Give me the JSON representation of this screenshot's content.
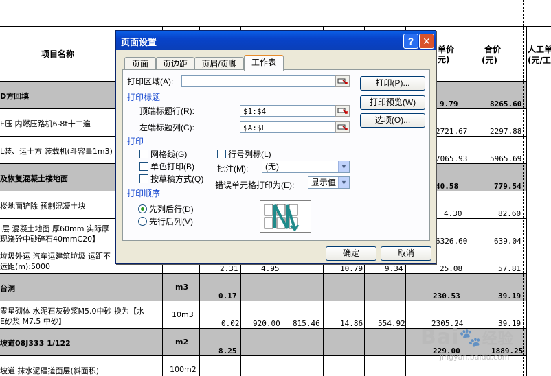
{
  "spreadsheet": {
    "headers": {
      "item_name": "项目名称",
      "unit_price": "单价",
      "unit_price_tail": "元)",
      "total": "合价",
      "total_unit": "(元)",
      "labor": "人工单",
      "labor_unit": "(元/工"
    },
    "rows": [
      {
        "name": "D方回填",
        "price": "9.79",
        "total": "8265.60"
      },
      {
        "name": "E压 内燃压路机6-8t十二遍",
        "price": "2721.67",
        "total": "2297.88"
      },
      {
        "name": "L装、运土方 装载机(斗容量1m3)",
        "price": "7065.93",
        "total": "5965.69"
      },
      {
        "name": "及恢复混凝土楼地面",
        "price": "40.58",
        "total": "779.54"
      },
      {
        "name": "楼地面铲除 预制混凝土块",
        "price": "4.30",
        "total": "82.60"
      },
      {
        "name": "i层 混凝土地面 厚60mm 实际厚",
        "name2": "现浇砼中砂碎石40mmC20】",
        "price": "6326.60",
        "total": "639.04"
      },
      {
        "name": "垃圾外运 汽车运建筑垃圾 运距不",
        "name2": "运距(m):5000",
        "c1": "2.31",
        "c2": "4.95",
        "c3": "10.79",
        "c4": "9.34",
        "price": "25.08",
        "total": "57.81"
      },
      {
        "name": "台洞",
        "unit": "m3",
        "qty": "0.17",
        "price": "230.53",
        "total": "39.19"
      },
      {
        "name": "零星砌体 水泥石灰砂浆M5.0中砂 换为【水",
        "name2": "E砂浆 M7.5 中砂】",
        "unit": "10m3",
        "qty": "0.02",
        "c1": "920.00",
        "c2": "815.46",
        "c3": "14.86",
        "c4": "554.92",
        "price": "2305.24",
        "total": "39.19"
      },
      {
        "name": "坡道08J333 1/122",
        "unit": "m2",
        "qty": "8.25",
        "price": "229.00",
        "total": "1889.25"
      },
      {
        "name": "坡道 抹水泥礓搓面层(斜面积)",
        "unit": "100m2"
      }
    ]
  },
  "dialog": {
    "title": "页面设置",
    "help_label": "?",
    "tabs": [
      "页面",
      "页边距",
      "页眉/页脚",
      "工作表"
    ],
    "active_tab": "工作表",
    "print_area_label": "打印区域(A):",
    "print_area_value": "",
    "print_titles_section": "打印标题",
    "top_rows_label": "顶端标题行(R):",
    "top_rows_value": "$1:$4",
    "left_cols_label": "左端标题列(C):",
    "left_cols_value": "$A:$L",
    "print_section": "打印",
    "gridlines_label": "网格线(G)",
    "row_col_headings_label": "行号列标(L)",
    "black_white_label": "单色打印(B)",
    "draft_label": "按草稿方式(Q)",
    "comments_label": "批注(M):",
    "comments_value": "(无)",
    "cell_errors_label": "错误单元格打印为(E):",
    "cell_errors_value": "显示值",
    "page_order_section": "打印顺序",
    "down_then_over_label": "先列后行(D)",
    "over_then_down_label": "先行后列(V)",
    "print_button": "打印(P)...",
    "preview_button": "打印预览(W)",
    "options_button": "选项(O)...",
    "ok_button": "确定",
    "cancel_button": "取消"
  },
  "watermark": {
    "brand": "Bai",
    "brand2": "经验",
    "url": "jingyan.baidu.com"
  },
  "colors": {
    "title_bar": "#0a4fd4",
    "dialog_bg": "#ece9d8",
    "section_text": "#1a4bd0",
    "band_gray": "#c0c0c0"
  }
}
